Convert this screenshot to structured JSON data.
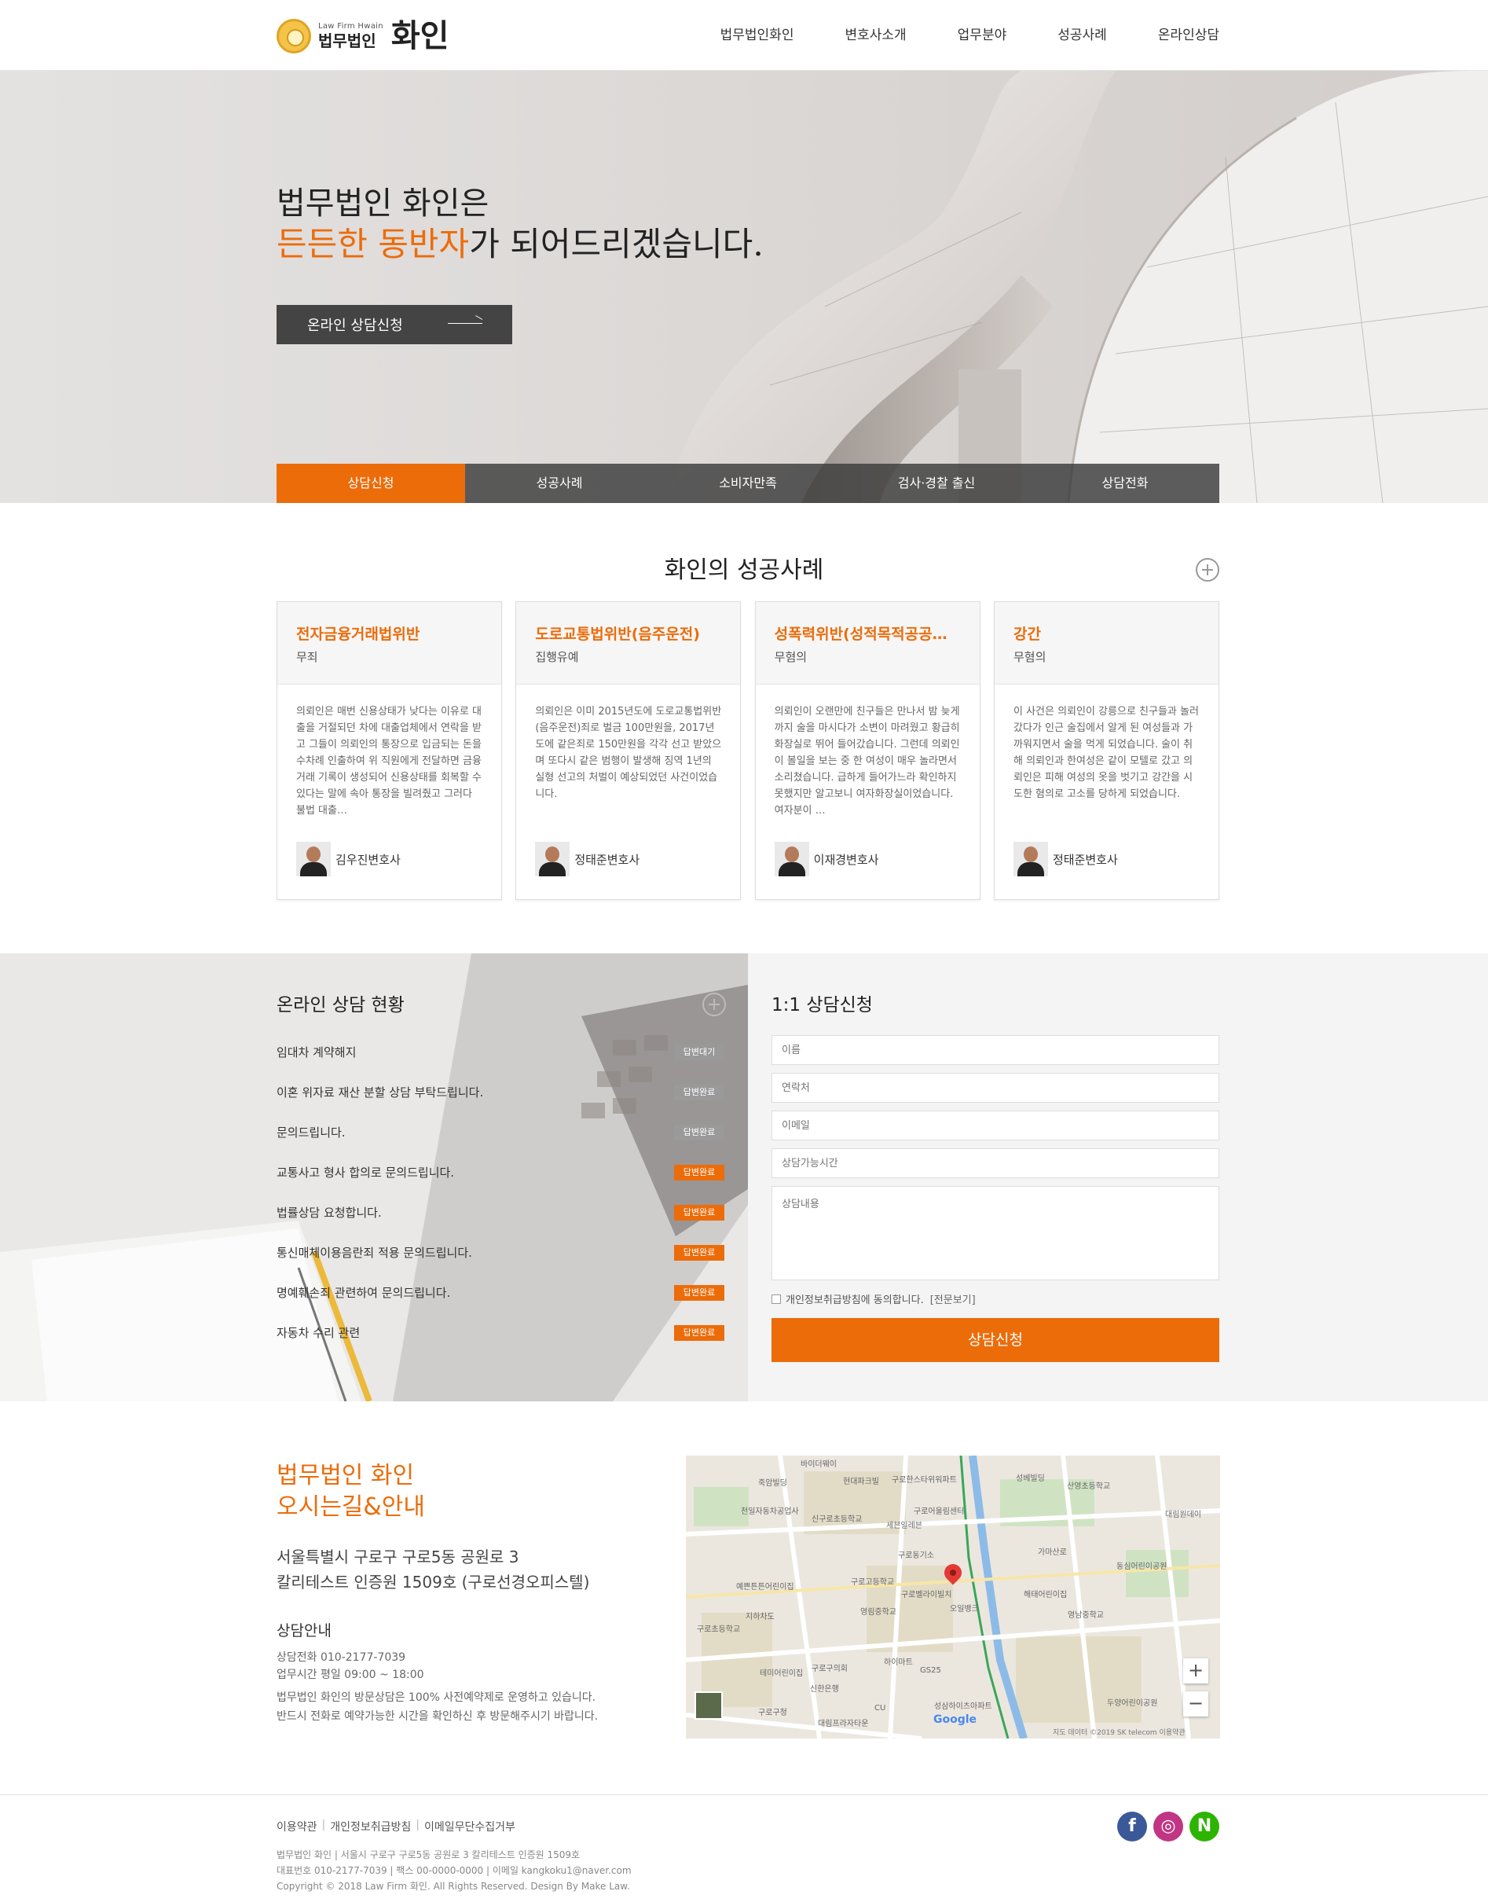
{
  "header": {
    "logo_en": "Law Firm Hwain",
    "logo_ko": "법무법인",
    "logo_big": "화인",
    "nav": [
      "법무법인화인",
      "변호사소개",
      "업무분야",
      "성공사례",
      "온라인상담"
    ]
  },
  "hero": {
    "title_line1": "법무법인 화인은",
    "title_highlight": "든든한 동반자",
    "title_rest": "가 되어드리겠습니다.",
    "button_label": "온라인 상담신청",
    "quick_tabs": [
      "상담신청",
      "성공사례",
      "소비자만족",
      "검사·경찰 출신",
      "상담전화"
    ]
  },
  "cases": {
    "title": "화인의 성공사례",
    "items": [
      {
        "title": "전자금융거래법위반",
        "result": "무죄",
        "body": "의뢰인은 매번 신용상태가 낮다는 이유로 대출을 거절되던 차에 대출업체에서 연락을 받고 그들이 의뢰인의 통장으로 입금되는 돈을 수차례 인출하여 위 직원에게 전달하면 금융거래 기록이 생성되어 신용상태를 회복할 수 있다는 말에 속아 통장을 빌려줬고 그러다 불법 대출…",
        "lawyer": "김우진변호사"
      },
      {
        "title": "도로교통법위반(음주운전)",
        "result": "집행유예",
        "body": "의뢰인은 이미 2015년도에 도로교통법위반(음주운전)죄로 벌금 100만원을, 2017년도에 같은죄로 150만원을 각각 선고 받았으며 또다시 같은 범행이 발생해 징역 1년의 실형 선고의 처벌이 예상되었던 사건이었습니다.",
        "lawyer": "정태준변호사"
      },
      {
        "title": "성폭력위반(성적목적공공…",
        "result": "무혐의",
        "body": "의뢰인이 오랜만에 친구들은 만나서 밤 늦게까지 술을 마시다가 소변이 마려웠고 황급히 화장실로 뛰어 들어갔습니다. 그런데 의뢰인이 볼일을 보는 중 한 여성이 매우 놀라면서 소리쳤습니다. 급하게 들어가느라 확인하지 못했지만 알고보니 여자화장실이었습니다. 여자분이 …",
        "lawyer": "이재경변호사"
      },
      {
        "title": "강간",
        "result": "무혐의",
        "body": "이 사건은 의뢰인이 강릉으로 친구들과 놀러갔다가 인근 술집에서 알게 된 여성들과 가까워지면서 술을 먹게 되었습니다. 술이 취해 의뢰인과 한여성은 같이 모텔로 갔고 의뢰인은 피해 여성의 옷을 벗기고 강간을 시도한 혐의로 고소를 당하게 되었습니다.",
        "lawyer": "정태준변호사"
      }
    ]
  },
  "consult_status": {
    "title": "온라인 상담 현황",
    "items": [
      {
        "text": "임대차 계약해지",
        "status": "답변대기"
      },
      {
        "text": "이혼 위자료 재산 분할 상담 부탁드립니다.",
        "status": "답변완료"
      },
      {
        "text": "문의드립니다.",
        "status": "답변완료"
      },
      {
        "text": "교통사고 형사 합의로 문의드립니다.",
        "status": "답변완료"
      },
      {
        "text": "법률상담 요청합니다.",
        "status": "답변완료"
      },
      {
        "text": "통신매체이용음란죄 적용 문의드립니다.",
        "status": "답변완료"
      },
      {
        "text": "명예훼손죄 관련하여 문의드립니다.",
        "status": "답변완료"
      },
      {
        "text": "자동차 수리 관련",
        "status": "답변완료"
      }
    ]
  },
  "consult_form": {
    "title": "1:1 상담신청",
    "name_placeholder": "이름",
    "phone_placeholder": "연락처",
    "email_placeholder": "이메일",
    "time_placeholder": "상담가능시간",
    "content_placeholder": "상담내용",
    "agree_label": "개인정보취급방침에 동의합니다.",
    "agree_link": "[전문보기]",
    "submit_label": "상담신청"
  },
  "location": {
    "title1": "법무법인 화인",
    "title2": "오시는길&안내",
    "address_line1": "서울특별시 구로구 구로5동 공원로 3",
    "address_line2": "칼리테스트 인증원 1509호 (구로선경오피스텔)",
    "consult_title": "상담안내",
    "phone": "상담전화   010-2177-7039",
    "hours": "업무시간   평일 09:00 ~ 18:00",
    "note_line1": "법무법인 화인의 방문상담은 100% 사전예약제로 운영하고 있습니다.",
    "note_line2": "반드시 전화로 예약가능한 시간을 확인하신 후 방문해주시기 바랍니다."
  },
  "map": {
    "labels": [
      "바이더웨이",
      "죽암빌딩",
      "현대파크빌",
      "구로한스타위워파트",
      "성베빌딩",
      "산영초등학교",
      "천일자동차공업사",
      "신구로초등학교",
      "세븐일레븐",
      "구로어울림센터",
      "구로동기소",
      "예쁜튼튼어린이집",
      "구로고등학교",
      "구로벨라이빌치",
      "오일뱅크",
      "해태어린이집",
      "구로초등학교",
      "지하차도",
      "영림중학교",
      "영남중학교",
      "테미어린이집",
      "구로구의회",
      "하이마트",
      "GS25",
      "신한은행",
      "CU",
      "구로구청",
      "대림프라자타운",
      "성삼하이츠아파트",
      "두양어린이공원",
      "가마산로",
      "대림원데이",
      "동심어린이공원"
    ],
    "google": "Google",
    "copyright": "지도 데이터 ©2019 SK telecom  이용약관",
    "zoom_in": "+",
    "zoom_out": "−"
  },
  "footer": {
    "links": [
      "이용약관",
      "개인정보취급방침",
      "이메일무단수집거부"
    ],
    "info_line1": "법무법인 화인 | 서울시 구로구 구로5동 공원로 3 칼리테스트 인증원 1509호",
    "info_line2": "대표번호 010-2177-7039 | 팩스 00-0000-0000 | 이메일 kangkoku1@naver.com",
    "info_line3": "Copyright © 2018 Law Firm 화인. All Rights Reserved. Design By Make Law.",
    "sns": [
      "f",
      "◎",
      "N"
    ]
  },
  "colors": {
    "accent": "#ec6c0a",
    "dark_button": "#444444",
    "facebook": "#3b5998",
    "instagram": "#c13584",
    "naver": "#2db400"
  }
}
